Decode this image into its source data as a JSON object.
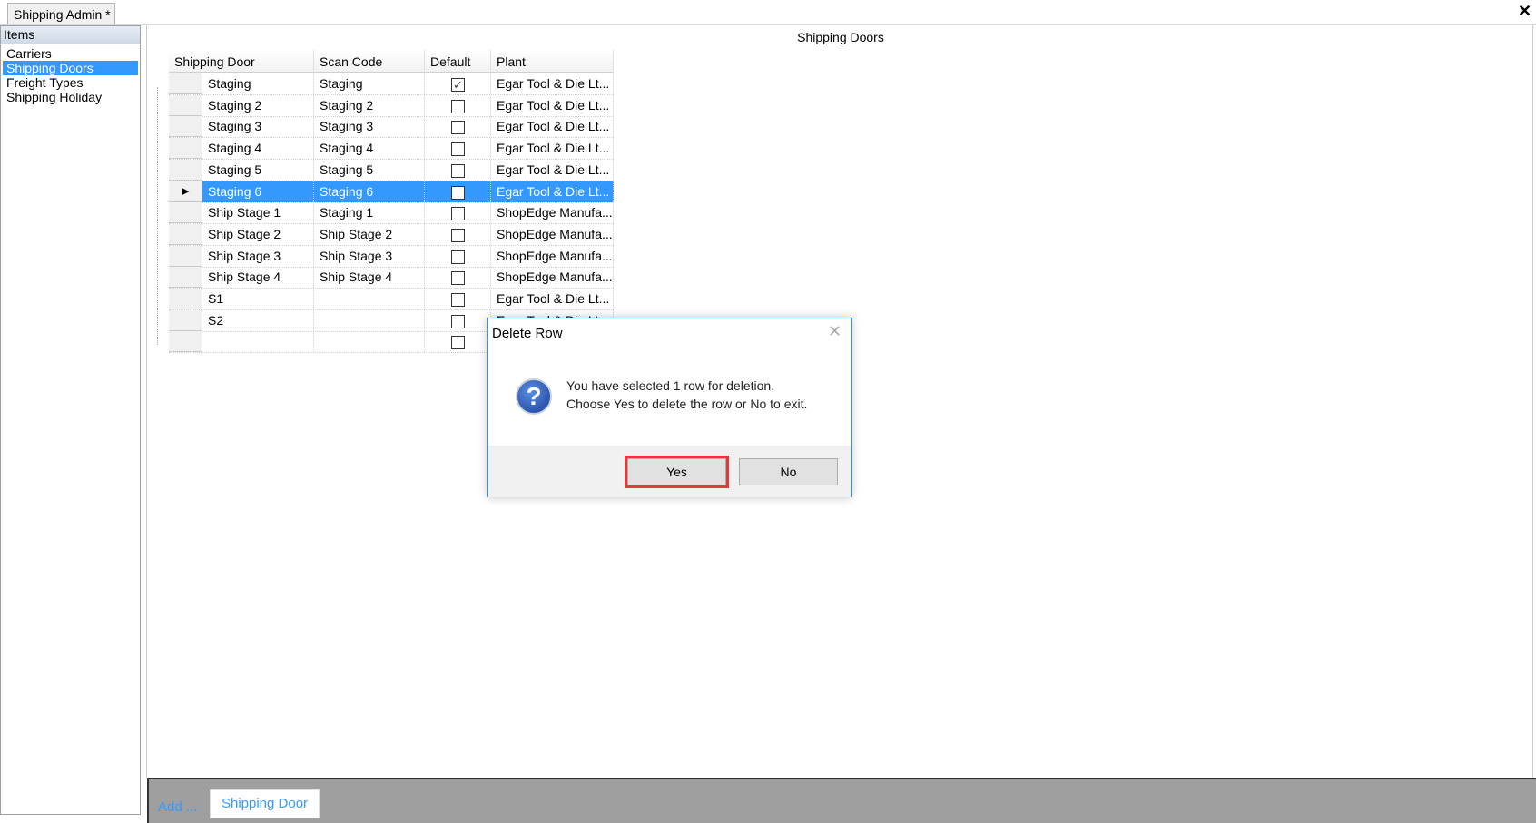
{
  "tab": {
    "label": "Shipping Admin *"
  },
  "window": {
    "close_icon": "close-x"
  },
  "sidebar": {
    "header": "Items",
    "items": [
      {
        "label": "Carriers"
      },
      {
        "label": "Shipping Doors",
        "selected": true
      },
      {
        "label": "Freight Types"
      },
      {
        "label": "Shipping Holiday"
      }
    ]
  },
  "main": {
    "title": "Shipping Doors"
  },
  "grid": {
    "columns": [
      "Shipping Door",
      "Scan Code",
      "Default",
      "Plant"
    ],
    "rows": [
      {
        "door": "Staging",
        "scan": "Staging",
        "default": true,
        "plant": "Egar Tool & Die Lt..."
      },
      {
        "door": "Staging 2",
        "scan": "Staging 2",
        "default": false,
        "plant": "Egar Tool & Die Lt..."
      },
      {
        "door": "Staging 3",
        "scan": "Staging 3",
        "default": false,
        "plant": "Egar Tool & Die Lt..."
      },
      {
        "door": "Staging 4",
        "scan": "Staging 4",
        "default": false,
        "plant": "Egar Tool & Die Lt..."
      },
      {
        "door": "Staging 5",
        "scan": "Staging 5",
        "default": false,
        "plant": "Egar Tool & Die Lt..."
      },
      {
        "door": "Staging 6",
        "scan": "Staging 6",
        "default": false,
        "plant": "Egar Tool & Die Lt...",
        "selected": true
      },
      {
        "door": "Ship Stage 1",
        "scan": "Staging 1",
        "default": false,
        "plant": "ShopEdge  Manufa..."
      },
      {
        "door": "Ship Stage 2",
        "scan": "Ship Stage 2",
        "default": false,
        "plant": "ShopEdge  Manufa..."
      },
      {
        "door": "Ship Stage 3",
        "scan": "Ship Stage 3",
        "default": false,
        "plant": "ShopEdge  Manufa..."
      },
      {
        "door": "Ship Stage 4",
        "scan": "Ship Stage 4",
        "default": false,
        "plant": "ShopEdge  Manufa..."
      },
      {
        "door": "S1",
        "scan": "",
        "default": false,
        "plant": "Egar Tool & Die Lt..."
      },
      {
        "door": "S2",
        "scan": "",
        "default": false,
        "plant": "Egar Tool & Die Lt..."
      },
      {
        "door": "",
        "scan": "",
        "default": false,
        "plant": ""
      }
    ]
  },
  "dialog": {
    "title": "Delete Row",
    "icon": "question-icon",
    "line1": "You have selected 1 row for deletion.",
    "line2": "Choose Yes to delete the row or No to exit.",
    "yes": "Yes",
    "no": "No"
  },
  "bottom": {
    "add_label": "Add ...",
    "button": "Shipping Door"
  },
  "colors": {
    "selection": "#3399ff",
    "highlight": "#e03a3a",
    "bar": "#9f9f9f"
  }
}
